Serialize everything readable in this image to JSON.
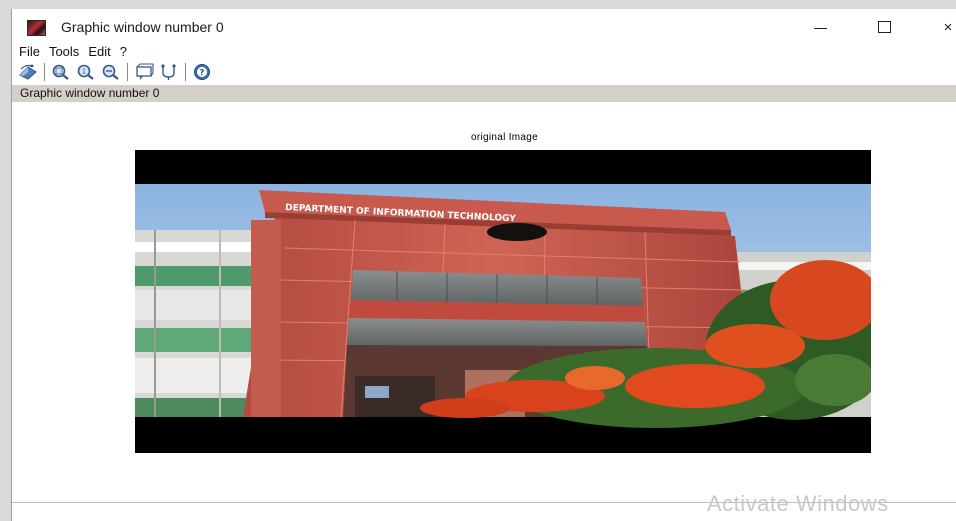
{
  "window": {
    "title": "Graphic window number 0",
    "controls": {
      "minimize": "—",
      "maximize": "☐",
      "close": "×"
    }
  },
  "menubar": {
    "items": [
      {
        "label": "File"
      },
      {
        "label": "Tools"
      },
      {
        "label": "Edit"
      },
      {
        "label": "?"
      }
    ]
  },
  "toolbar": {
    "buttons": [
      {
        "icon": "rotate-icon"
      },
      {
        "icon": "zoom-in-icon"
      },
      {
        "icon": "zoom-reset-icon"
      },
      {
        "icon": "zoom-out-icon"
      },
      {
        "icon": "datatip-icon"
      },
      {
        "icon": "edit-axes-icon"
      },
      {
        "icon": "help-icon"
      }
    ]
  },
  "infobar": {
    "text": "Graphic window number 0"
  },
  "figure": {
    "title": "original Image",
    "image_text": "DEPARTMENT OF INFORMATION TECHNOLOGY"
  },
  "watermark": {
    "text": "Activate Windows"
  },
  "colors": {
    "infobar_bg": "#d4d0c8",
    "building_red": "#c2554a",
    "sky": "#9fbfe0",
    "flowers": "#e0401e"
  }
}
